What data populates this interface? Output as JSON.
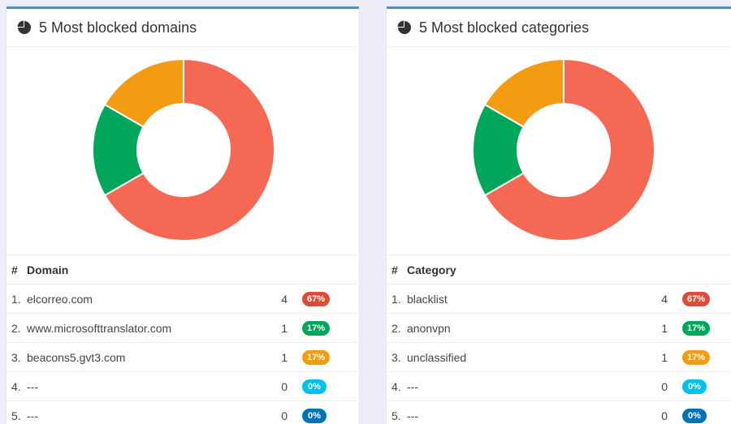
{
  "colors": {
    "red": "#f56954",
    "green": "#00a65a",
    "orange": "#f39c12",
    "cyan": "#00c0ef",
    "blue": "#0073b7",
    "badge_red": "#dd4b39"
  },
  "domains": {
    "title": "5 Most blocked domains",
    "icon": "pie-chart-icon",
    "col_num": "#",
    "col_name": "Domain",
    "rows": [
      {
        "num": "1.",
        "name": "elcorreo.com",
        "count": "4",
        "pct": "67%",
        "color": "#dd4b39"
      },
      {
        "num": "2.",
        "name": "www.microsofttranslator.com",
        "count": "1",
        "pct": "17%",
        "color": "#00a65a"
      },
      {
        "num": "3.",
        "name": "beacons5.gvt3.com",
        "count": "1",
        "pct": "17%",
        "color": "#f39c12"
      },
      {
        "num": "4.",
        "name": "---",
        "count": "0",
        "pct": "0%",
        "color": "#00c0ef"
      },
      {
        "num": "5.",
        "name": "---",
        "count": "0",
        "pct": "0%",
        "color": "#0073b7"
      }
    ]
  },
  "categories": {
    "title": "5 Most blocked categories",
    "icon": "pie-chart-icon",
    "col_num": "#",
    "col_name": "Category",
    "rows": [
      {
        "num": "1.",
        "name": "blacklist",
        "count": "4",
        "pct": "67%",
        "color": "#dd4b39"
      },
      {
        "num": "2.",
        "name": "anonvpn",
        "count": "1",
        "pct": "17%",
        "color": "#00a65a"
      },
      {
        "num": "3.",
        "name": "unclassified",
        "count": "1",
        "pct": "17%",
        "color": "#f39c12"
      },
      {
        "num": "4.",
        "name": "---",
        "count": "0",
        "pct": "0%",
        "color": "#00c0ef"
      },
      {
        "num": "5.",
        "name": "---",
        "count": "0",
        "pct": "0%",
        "color": "#0073b7"
      }
    ]
  },
  "chart_data": [
    {
      "type": "pie",
      "categories": [
        "elcorreo.com",
        "www.microsofttranslator.com",
        "beacons5.gvt3.com",
        "---",
        "---"
      ],
      "values": [
        4,
        1,
        1,
        0,
        0
      ],
      "colors": [
        "#f56954",
        "#00a65a",
        "#f39c12",
        "#00c0ef",
        "#0073b7"
      ]
    },
    {
      "type": "pie",
      "categories": [
        "blacklist",
        "anonvpn",
        "unclassified",
        "---",
        "---"
      ],
      "values": [
        4,
        1,
        1,
        0,
        0
      ],
      "colors": [
        "#f56954",
        "#00a65a",
        "#f39c12",
        "#00c0ef",
        "#0073b7"
      ]
    }
  ]
}
